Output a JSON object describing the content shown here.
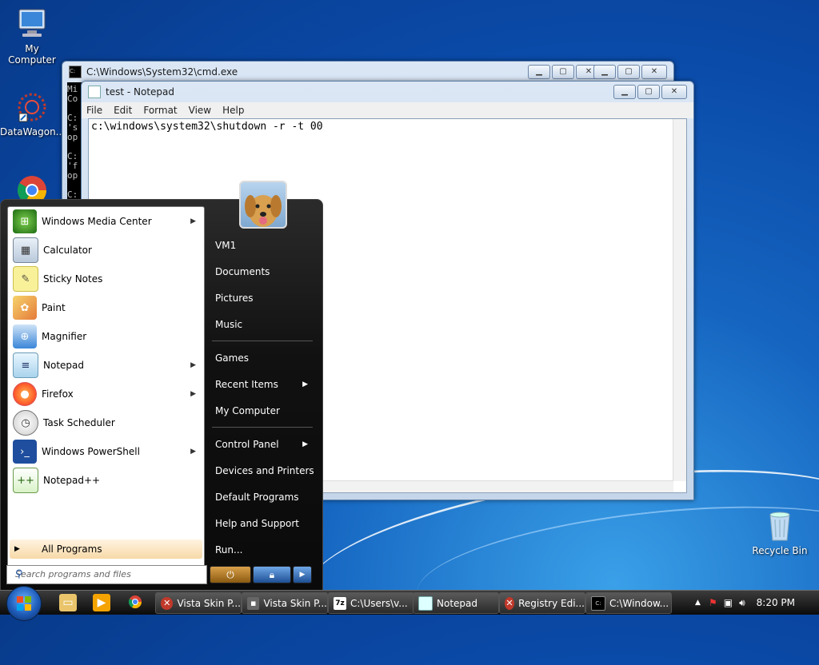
{
  "desktop": {
    "icons": [
      {
        "label": "My Computer",
        "icon": "computer-icon"
      },
      {
        "label": "DataWagon...",
        "icon": "datawagon-icon"
      },
      {
        "label": "",
        "icon": "chrome-icon"
      },
      {
        "label": "Recycle Bin",
        "icon": "recycle-bin-icon"
      }
    ]
  },
  "cmd_window": {
    "title": "C:\\Windows\\System32\\cmd.exe",
    "visible_fragments": [
      "Mi",
      "Co",
      "C:",
      "'s",
      "op",
      "C:",
      "'f",
      "op",
      "C:"
    ]
  },
  "notepad": {
    "title": "test - Notepad",
    "menu": [
      "File",
      "Edit",
      "Format",
      "View",
      "Help"
    ],
    "content": "c:\\windows\\system32\\shutdown -r -t 00"
  },
  "start_menu": {
    "programs": [
      {
        "label": "Windows Media Center",
        "icon": "windows-media-center-icon",
        "arrow": true
      },
      {
        "label": "Calculator",
        "icon": "calculator-icon",
        "arrow": false
      },
      {
        "label": "Sticky Notes",
        "icon": "sticky-notes-icon",
        "arrow": false
      },
      {
        "label": "Paint",
        "icon": "paint-icon",
        "arrow": false
      },
      {
        "label": "Magnifier",
        "icon": "magnifier-icon",
        "arrow": false
      },
      {
        "label": "Notepad",
        "icon": "notepad-icon",
        "arrow": true
      },
      {
        "label": "Firefox",
        "icon": "firefox-icon",
        "arrow": true
      },
      {
        "label": "Task Scheduler",
        "icon": "task-scheduler-icon",
        "arrow": false
      },
      {
        "label": "Windows PowerShell",
        "icon": "powershell-icon",
        "arrow": true
      },
      {
        "label": "Notepad++",
        "icon": "notepadpp-icon",
        "arrow": false
      }
    ],
    "all_programs": "All Programs",
    "search_placeholder": "Search programs and files",
    "right_items": [
      {
        "label": "VM1",
        "arrow": false
      },
      {
        "label": "Documents",
        "arrow": false
      },
      {
        "label": "Pictures",
        "arrow": false
      },
      {
        "label": "Music",
        "arrow": false
      },
      {
        "label": "Games",
        "arrow": false
      },
      {
        "label": "Recent Items",
        "arrow": true
      },
      {
        "label": "My Computer",
        "arrow": false
      },
      {
        "label": "Control Panel",
        "arrow": true
      },
      {
        "label": "Devices and Printers",
        "arrow": false
      },
      {
        "label": "Default Programs",
        "arrow": false
      },
      {
        "label": "Help and Support",
        "arrow": false
      },
      {
        "label": "Run...",
        "arrow": false
      }
    ]
  },
  "taskbar": {
    "buttons": [
      {
        "label": "Vista Skin P...",
        "icon": "error-icon"
      },
      {
        "label": "Vista Skin P...",
        "icon": "app-icon"
      },
      {
        "label": "C:\\Users\\v...",
        "icon": "7zip-icon"
      },
      {
        "label": "Notepad",
        "icon": "notepad-icon"
      },
      {
        "label": "Registry Edi...",
        "icon": "error-icon"
      },
      {
        "label": "C:\\Window...",
        "icon": "cmd-icon"
      }
    ],
    "clock": "8:20 PM"
  },
  "colors": {
    "desktop_blue": "#0a4aa8",
    "start_menu_bg": "#111111",
    "all_programs_bg": "#f7d9a8"
  }
}
